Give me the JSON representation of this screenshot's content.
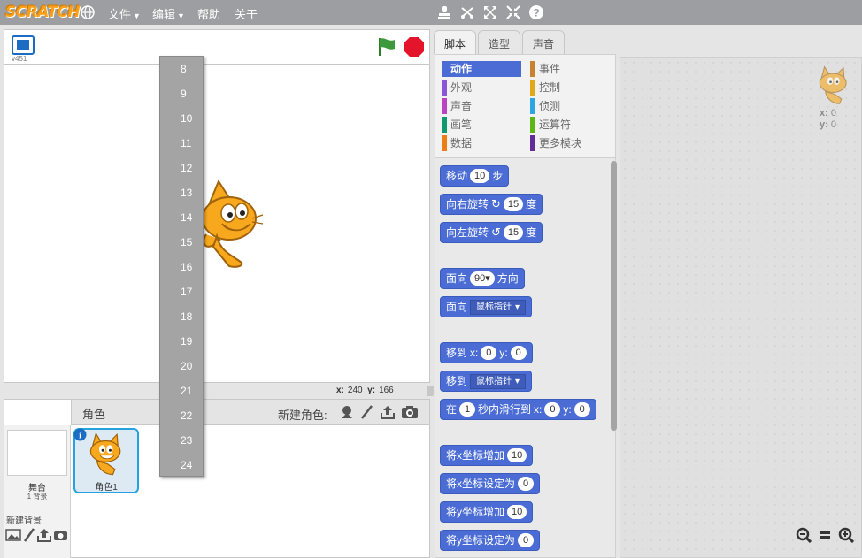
{
  "menu": {
    "logo": "SCRATCH",
    "file": "文件",
    "edit": "编辑",
    "help": "帮助",
    "about": "关于"
  },
  "stage": {
    "version": "v451",
    "coords": {
      "x_label": "x:",
      "x": "240",
      "y_label": "y:",
      "y": "166"
    }
  },
  "tabs": [
    {
      "label": "脚本"
    },
    {
      "label": "造型"
    },
    {
      "label": "声音"
    }
  ],
  "categories": [
    {
      "label": "动作",
      "color": "#4a6cd4"
    },
    {
      "label": "事件",
      "color": "#c88330"
    },
    {
      "label": "外观",
      "color": "#8a55d7"
    },
    {
      "label": "控制",
      "color": "#e1a91a"
    },
    {
      "label": "声音",
      "color": "#bb42c3"
    },
    {
      "label": "侦测",
      "color": "#2ca5e2"
    },
    {
      "label": "画笔",
      "color": "#0e9a6c"
    },
    {
      "label": "运算符",
      "color": "#5cb712"
    },
    {
      "label": "数据",
      "color": "#ee7d16"
    },
    {
      "label": "更多模块",
      "color": "#632d99"
    }
  ],
  "blocks": {
    "move": {
      "pre": "移动",
      "val": "10",
      "post": "步"
    },
    "turn_right": {
      "pre": "向右旋转",
      "icon": "↻",
      "val": "15",
      "post": "度"
    },
    "turn_left": {
      "pre": "向左旋转",
      "icon": "↺",
      "val": "15",
      "post": "度"
    },
    "point_dir": {
      "pre": "面向",
      "val": "90",
      "post": "方向"
    },
    "point_towards": {
      "pre": "面向",
      "dd": "鼠标指针"
    },
    "goto_xy": {
      "pre": "移到",
      "x_label": "x:",
      "x": "0",
      "y_label": "y:",
      "y": "0"
    },
    "goto": {
      "pre": "移到",
      "dd": "鼠标指针"
    },
    "glide": {
      "pre": "在",
      "secs": "1",
      "mid": "秒内滑行到",
      "x_label": "x:",
      "x": "0",
      "y_label": "y:",
      "y": "0"
    },
    "change_x": {
      "pre": "将x坐标增加",
      "val": "10"
    },
    "set_x": {
      "pre": "将x坐标设定为",
      "val": "0"
    },
    "change_y": {
      "pre": "将y坐标增加",
      "val": "10"
    },
    "set_y": {
      "pre": "将y坐标设定为",
      "val": "0"
    }
  },
  "sprites": {
    "header": "角色",
    "new_sprite": "新建角色:",
    "stage_label": "舞台",
    "stage_bg_count": "1 背景",
    "new_backdrop": "新建背景",
    "sprite_name": "角色1"
  },
  "script_area": {
    "x_label": "x:",
    "x": "0",
    "y_label": "y:",
    "y": "0"
  },
  "dropdown_items": [
    "8",
    "9",
    "10",
    "11",
    "12",
    "13",
    "14",
    "15",
    "16",
    "17",
    "18",
    "19",
    "20",
    "21",
    "22",
    "23",
    "24"
  ]
}
